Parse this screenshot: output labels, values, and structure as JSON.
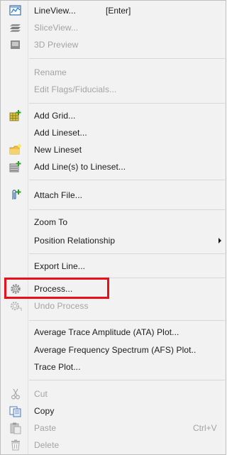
{
  "menu": {
    "items": [
      {
        "label": "LineView...",
        "shortcut": "[Enter]",
        "enabled": true
      },
      {
        "label": "SliceView...",
        "enabled": false
      },
      {
        "label": "3D Preview",
        "enabled": false
      },
      {
        "label": "Rename",
        "enabled": false
      },
      {
        "label": "Edit Flags/Fiducials...",
        "enabled": false
      },
      {
        "label": "Add Grid...",
        "enabled": true
      },
      {
        "label": "Add Lineset...",
        "enabled": true
      },
      {
        "label": "New Lineset",
        "enabled": true
      },
      {
        "label": "Add Line(s) to Lineset...",
        "enabled": true
      },
      {
        "label": "Attach File...",
        "enabled": true
      },
      {
        "label": "Zoom To",
        "enabled": true
      },
      {
        "label": "Position Relationship",
        "enabled": true,
        "submenu": true
      },
      {
        "label": "Export Line...",
        "enabled": true
      },
      {
        "label": "Process...",
        "enabled": true,
        "highlighted": true
      },
      {
        "label": "Undo Process",
        "enabled": false
      },
      {
        "label": "Average Trace Amplitude (ATA) Plot...",
        "enabled": true
      },
      {
        "label": "Average Frequency Spectrum (AFS) Plot..",
        "enabled": true
      },
      {
        "label": "Trace Plot...",
        "enabled": true
      },
      {
        "label": "Cut",
        "enabled": false
      },
      {
        "label": "Copy",
        "enabled": true
      },
      {
        "label": "Paste",
        "shortcut": "Ctrl+V",
        "enabled": false
      },
      {
        "label": "Delete",
        "enabled": false
      }
    ]
  },
  "colors": {
    "highlight_border": "#e8111a",
    "disabled_text": "#a3a3a3",
    "menu_background": "#f2f2f2"
  }
}
